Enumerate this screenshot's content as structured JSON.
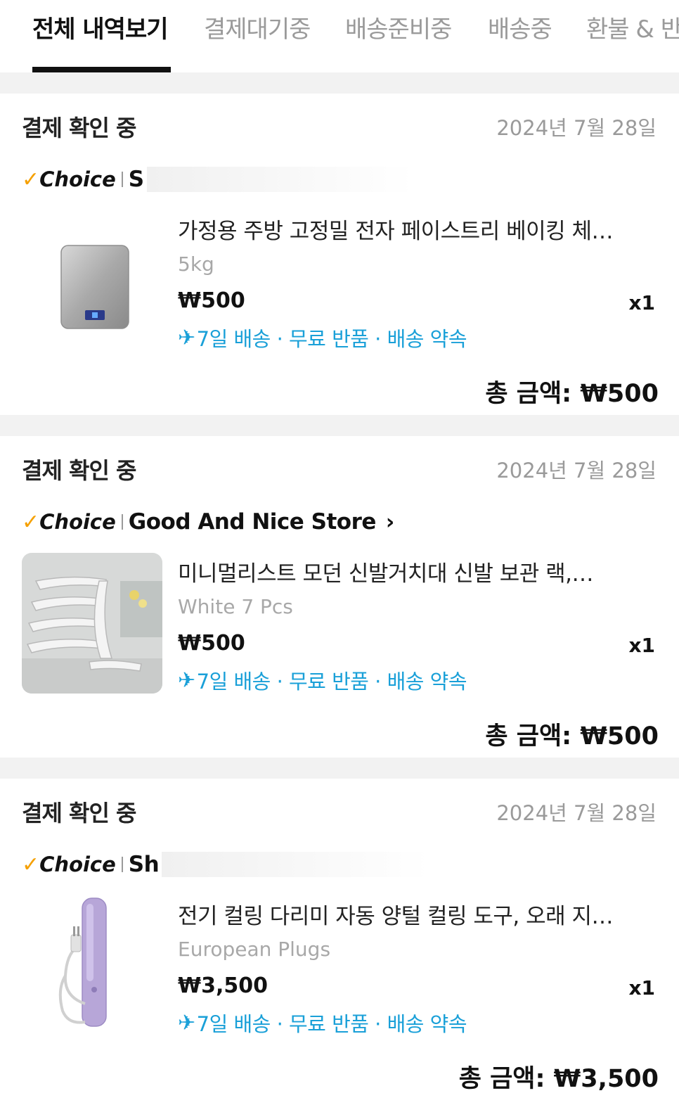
{
  "tabs": [
    {
      "label": "전체 내역보기",
      "active": true
    },
    {
      "label": "결제대기중",
      "active": false
    },
    {
      "label": "배송준비중",
      "active": false
    },
    {
      "label": "배송중",
      "active": false
    },
    {
      "label": "환불 & 반",
      "active": false
    }
  ],
  "orders": [
    {
      "status": "결제 확인 중",
      "date": "2024년 7월 28일",
      "choice_label": "Choice",
      "store_name": "S",
      "item_title": "가정용 주방 고정밀 전자 페이스트리 베이킹 체…",
      "variant": "5kg",
      "price": "₩500",
      "qty": "x1",
      "delivery_text": "7일 배송 · 무료 반품 · 배송 약속",
      "total": "총 금액: ₩500",
      "thumb_icon": "kitchen-scale-image"
    },
    {
      "status": "결제 확인 중",
      "date": "2024년 7월 28일",
      "choice_label": "Choice",
      "store_name": "Good And Nice Store",
      "item_title": "미니멀리스트 모던 신발거치대 신발 보관 랙,…",
      "variant": "White 7 Pcs",
      "price": "₩500",
      "qty": "x1",
      "delivery_text": "7일 배송 · 무료 반품 · 배송 약속",
      "total": "총 금액: ₩500",
      "thumb_icon": "shoe-rack-image"
    },
    {
      "status": "결제 확인 중",
      "date": "2024년 7월 28일",
      "choice_label": "Choice",
      "store_name": "Sh",
      "item_title": "전기 컬링 다리미 자동 양털 컬링 도구, 오래 지…",
      "variant": "European Plugs",
      "price": "₩3,500",
      "qty": "x1",
      "delivery_text": "7일 배송 · 무료 반품 · 배송 약속",
      "total": "총 금액: ₩3,500",
      "thumb_icon": "curling-iron-image"
    }
  ],
  "colors": {
    "accent_check": "#f5a000",
    "delivery_blue": "#1aa0d8",
    "muted": "#9a9a9a"
  }
}
